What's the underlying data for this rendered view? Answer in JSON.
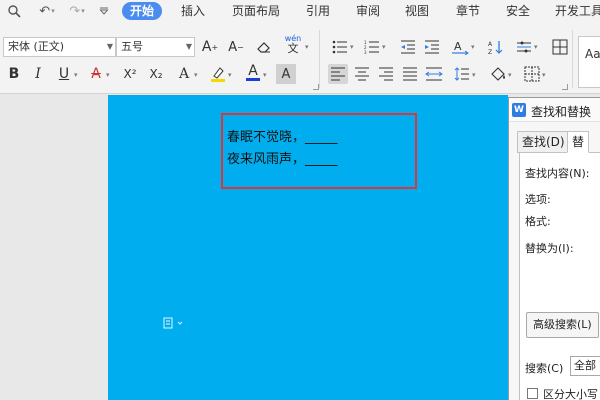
{
  "quick_access": {
    "preview_icon": "print-preview-icon",
    "undo_icon": "undo-icon",
    "redo_icon": "redo-icon",
    "customize_icon": "customize-icon"
  },
  "menu": {
    "tabs": [
      {
        "label": "开始",
        "active": true
      },
      {
        "label": "插入"
      },
      {
        "label": "页面布局"
      },
      {
        "label": "引用"
      },
      {
        "label": "审阅"
      },
      {
        "label": "视图"
      },
      {
        "label": "章节"
      },
      {
        "label": "安全"
      },
      {
        "label": "开发工具"
      }
    ]
  },
  "ribbon": {
    "font_name": "宋体 (正文)",
    "font_size": "五号",
    "grow_font": "A",
    "shrink_font": "A",
    "pinyin": "wén",
    "bold": "B",
    "italic": "I",
    "underline": "U",
    "strikethrough": "A",
    "superscript": "X²",
    "subscript": "X₂",
    "text_effect": "A",
    "font_color": "A",
    "char_shading": "A",
    "styles_preview": "Aa",
    "highlight_color": "#f5d800",
    "font_color_value": "#1a3fd6"
  },
  "document": {
    "page_color": "#00aeef",
    "lines": [
      "春眠不觉晓，_____",
      "夜来风雨声，_____"
    ],
    "textbox_border_color": "#d9363e"
  },
  "dialog": {
    "title": "查找和替换",
    "tabs": [
      {
        "label": "查找(D)"
      },
      {
        "label": "替",
        "active": true
      }
    ],
    "find_label": "查找内容(N):",
    "options_label": "选项:",
    "format_label": "格式:",
    "replace_label": "替换为(I):",
    "advanced_button": "高级搜索(L)",
    "search_label": "搜索(C)",
    "search_value": "全部",
    "match_case_label": "区分大小写"
  }
}
